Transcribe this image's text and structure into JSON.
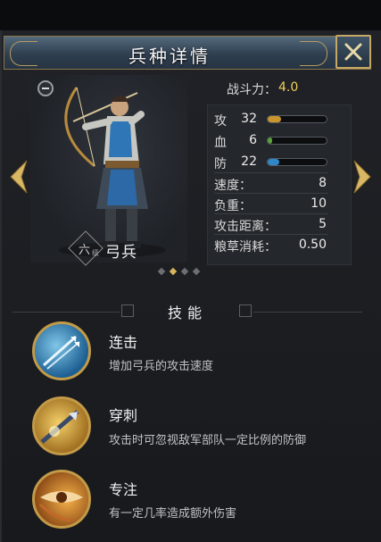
{
  "header": {
    "title": "兵种详情"
  },
  "unit": {
    "rank_char": "六",
    "rank_sub": "级",
    "name": "弓兵"
  },
  "power": {
    "label": "战斗力：",
    "value": "4.0"
  },
  "stats_bars": [
    {
      "label": "攻",
      "value": "32",
      "fill": 0.22,
      "color": "#c9962e"
    },
    {
      "label": "血",
      "value": "6",
      "fill": 0.08,
      "color": "#5aa43a"
    },
    {
      "label": "防",
      "value": "22",
      "fill": 0.2,
      "color": "#2f87c9"
    }
  ],
  "stats_text": [
    {
      "label": "速度：",
      "value": "8"
    },
    {
      "label": "负重：",
      "value": "10"
    },
    {
      "label": "攻击距离：",
      "value": "5"
    },
    {
      "label": "粮草消耗：",
      "value": "0.50"
    }
  ],
  "pager": {
    "count": 4,
    "active_index": 1
  },
  "skills_section": {
    "title": "技能"
  },
  "skills": [
    {
      "name": "连击",
      "desc": "增加弓兵的攻击速度",
      "icon": "multi-arrow-icon"
    },
    {
      "name": "穿刺",
      "desc": "攻击时可忽视敌军部队一定比例的防御",
      "icon": "piercing-arrow-icon"
    },
    {
      "name": "专注",
      "desc": "有一定几率造成额外伤害",
      "icon": "focus-eye-icon"
    }
  ],
  "colors": {
    "gold": "#c5a866",
    "power": "#f1cd58",
    "frame": "#8a7648"
  }
}
